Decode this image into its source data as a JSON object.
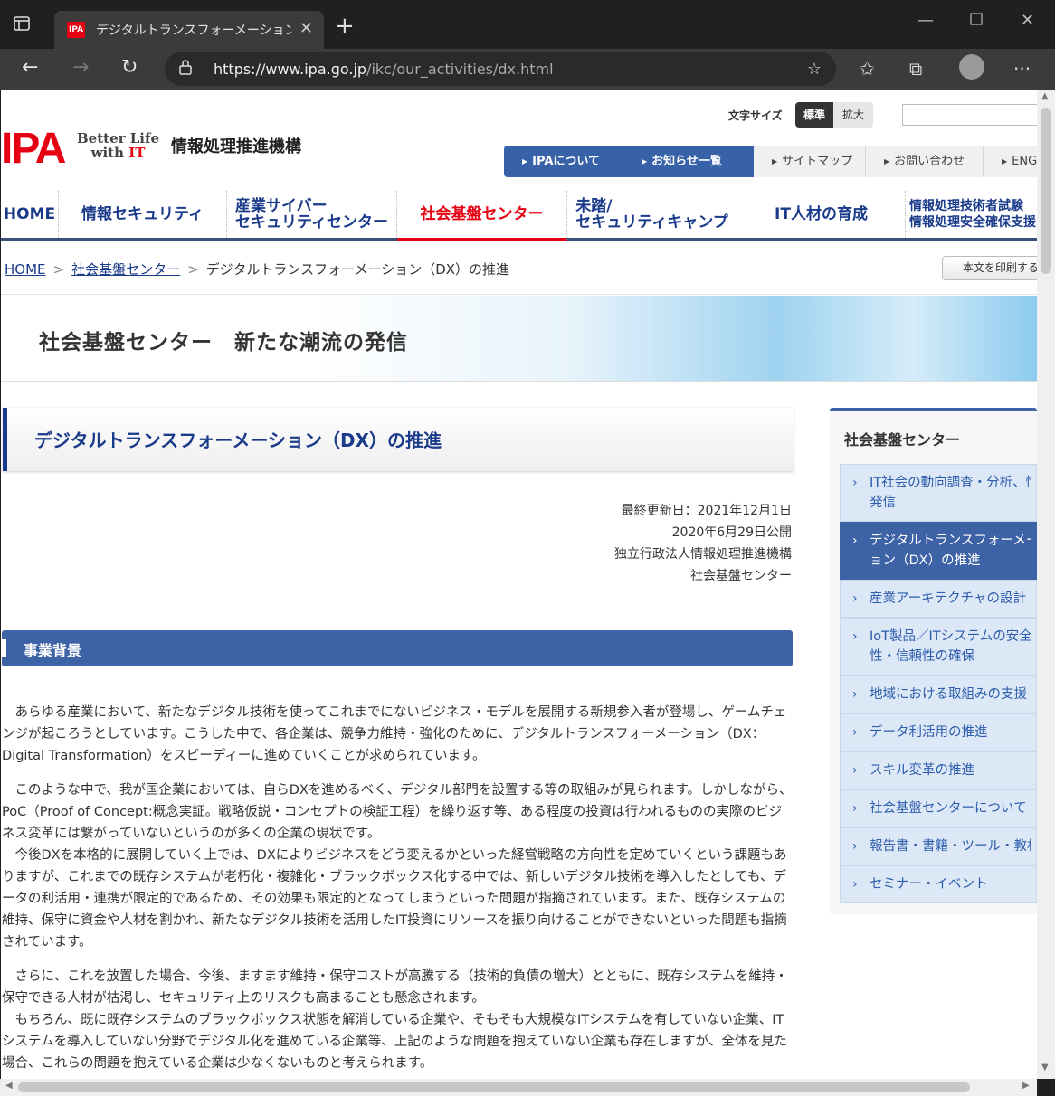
{
  "browser": {
    "tab_title": "デジタルトランスフォーメーション（DX）",
    "tab_favicon": "IPA",
    "url_host": "https://www.ipa.go.jp",
    "url_path": "/ikc/our_activities/dx.html",
    "icons": {
      "tab_actions": "tab-actions-icon",
      "close_tab": "close-icon",
      "new_tab": "plus-icon",
      "minimize": "minimize-icon",
      "maximize": "maximize-icon",
      "close_window": "close-icon",
      "back": "back-arrow-icon",
      "forward": "forward-arrow-icon",
      "refresh": "refresh-icon",
      "lock": "lock-icon",
      "add_favorite": "star-add-icon",
      "favorites": "favorites-icon",
      "collections": "collections-icon",
      "profile": "avatar-icon",
      "menu": "more-icon"
    }
  },
  "header": {
    "logo_text": "IPA",
    "tagline_line1": "Better Life",
    "tagline_line2_pre": "with ",
    "tagline_line2_it": "IT",
    "org_name": "情報処理推進機構",
    "font_size_label": "文字サイズ",
    "font_size_standard": "標準",
    "font_size_large": "拡大",
    "util_nav": [
      {
        "label": "IPAについて"
      },
      {
        "label": "お知らせ一覧"
      },
      {
        "label": "サイトマップ"
      },
      {
        "label": "お問い合わせ"
      },
      {
        "label": "ENG"
      }
    ]
  },
  "global_nav": [
    {
      "line1": "HOME",
      "line2": ""
    },
    {
      "line1": "情報セキュリティ",
      "line2": ""
    },
    {
      "line1": "産業サイバー",
      "line2": "セキュリティセンター"
    },
    {
      "line1": "社会基盤センター",
      "line2": ""
    },
    {
      "line1": "未踏/",
      "line2": "セキュリティキャンプ"
    },
    {
      "line1": "IT人材の育成",
      "line2": ""
    },
    {
      "line1": "情報処理技術者試験",
      "line2": "情報処理安全確保支援"
    }
  ],
  "breadcrumb": {
    "home": "HOME",
    "section": "社会基盤センター",
    "current": "デジタルトランスフォーメーション（DX）の推進",
    "sep": ">"
  },
  "print_button": "本文を印刷する",
  "banner_title": "社会基盤センター　新たな潮流の発信",
  "page_title": "デジタルトランスフォーメーション（DX）の推進",
  "meta": {
    "updated": "最終更新日：2021年12月1日",
    "published": "2020年6月29日公開",
    "org": "独立行政法人情報処理推進機構",
    "dept": "社会基盤センター"
  },
  "section_heading": "事業背景",
  "paragraphs": [
    "あらゆる産業において、新たなデジタル技術を使ってこれまでにないビジネス・モデルを展開する新規参入者が登場し、ゲームチェンジが起ころうとしています。こうした中で、各企業は、競争力維持・強化のために、デジタルトランスフォーメーション（DX：Digital Transformation）をスピーディーに進めていくことが求められています。",
    "このような中で、我が国企業においては、自らDXを進めるべく、デジタル部門を設置する等の取組みが見られます。しかしながら、PoC（Proof of Concept:概念実証。戦略仮説・コンセプトの検証工程）を繰り返す等、ある程度の投資は行われるものの実際のビジネス変革には繋がっていないというのが多くの企業の現状です。",
    "今後DXを本格的に展開していく上では、DXによりビジネスをどう変えるかといった経営戦略の方向性を定めていくという課題もありますが、これまでの既存システムが老朽化・複雑化・ブラックボックス化する中では、新しいデジタル技術を導入したとしても、データの利活用・連携が限定的であるため、その効果も限定的となってしまうといった問題が指摘されています。また、既存システムの維持、保守に資金や人材を割かれ、新たなデジタル技術を活用したIT投資にリソースを振り向けることができないといった問題も指摘されています。",
    "さらに、これを放置した場合、今後、ますます維持・保守コストが高騰する（技術的負債の増大）とともに、既存システムを維持・保守できる人材が枯渇し、セキュリティ上のリスクも高まることも懸念されます。",
    "もちろん、既に既存システムのブラックボックス状態を解消している企業や、そもそも大規模なITシステムを有していない企業、ITシステムを導入していない分野でデジタル化を進めている企業等、上記のような問題を抱えていない企業も存在しますが、全体を見た場合、これらの問題を抱えている企業は少なくないものと考えられます。"
  ],
  "sidenav": {
    "title": "社会基盤センター",
    "items": [
      {
        "line1": "IT社会の動向調査・分析、情",
        "line2": "発信"
      },
      {
        "line1": "デジタルトランスフォーメー",
        "line2": "ョン（DX）の推進"
      },
      {
        "line1": "産業アーキテクチャの設計",
        "line2": ""
      },
      {
        "line1": "IoT製品／ITシステムの安全",
        "line2": "性・信頼性の確保"
      },
      {
        "line1": "地域における取組みの支援",
        "line2": ""
      },
      {
        "line1": "データ利活用の推進",
        "line2": ""
      },
      {
        "line1": "スキル変革の推進",
        "line2": ""
      },
      {
        "line1": "社会基盤センターについて",
        "line2": ""
      },
      {
        "line1": "報告書・書籍・ツール・教材",
        "line2": ""
      },
      {
        "line1": "セミナー・イベント",
        "line2": ""
      }
    ]
  },
  "colors": {
    "brand_red": "#e60012",
    "nav_blue": "#1a3a8a",
    "section_blue": "#3e62a6"
  }
}
